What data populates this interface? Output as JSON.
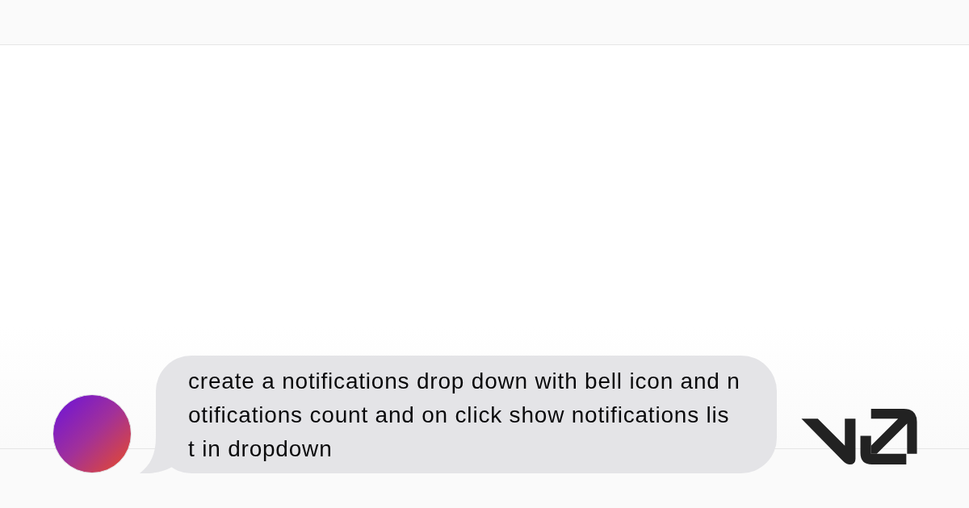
{
  "message": {
    "lines": [
      "create a notifications drop down with bell icon and n",
      "otifications count and on click show notifications lis",
      "t in dropdown"
    ]
  }
}
